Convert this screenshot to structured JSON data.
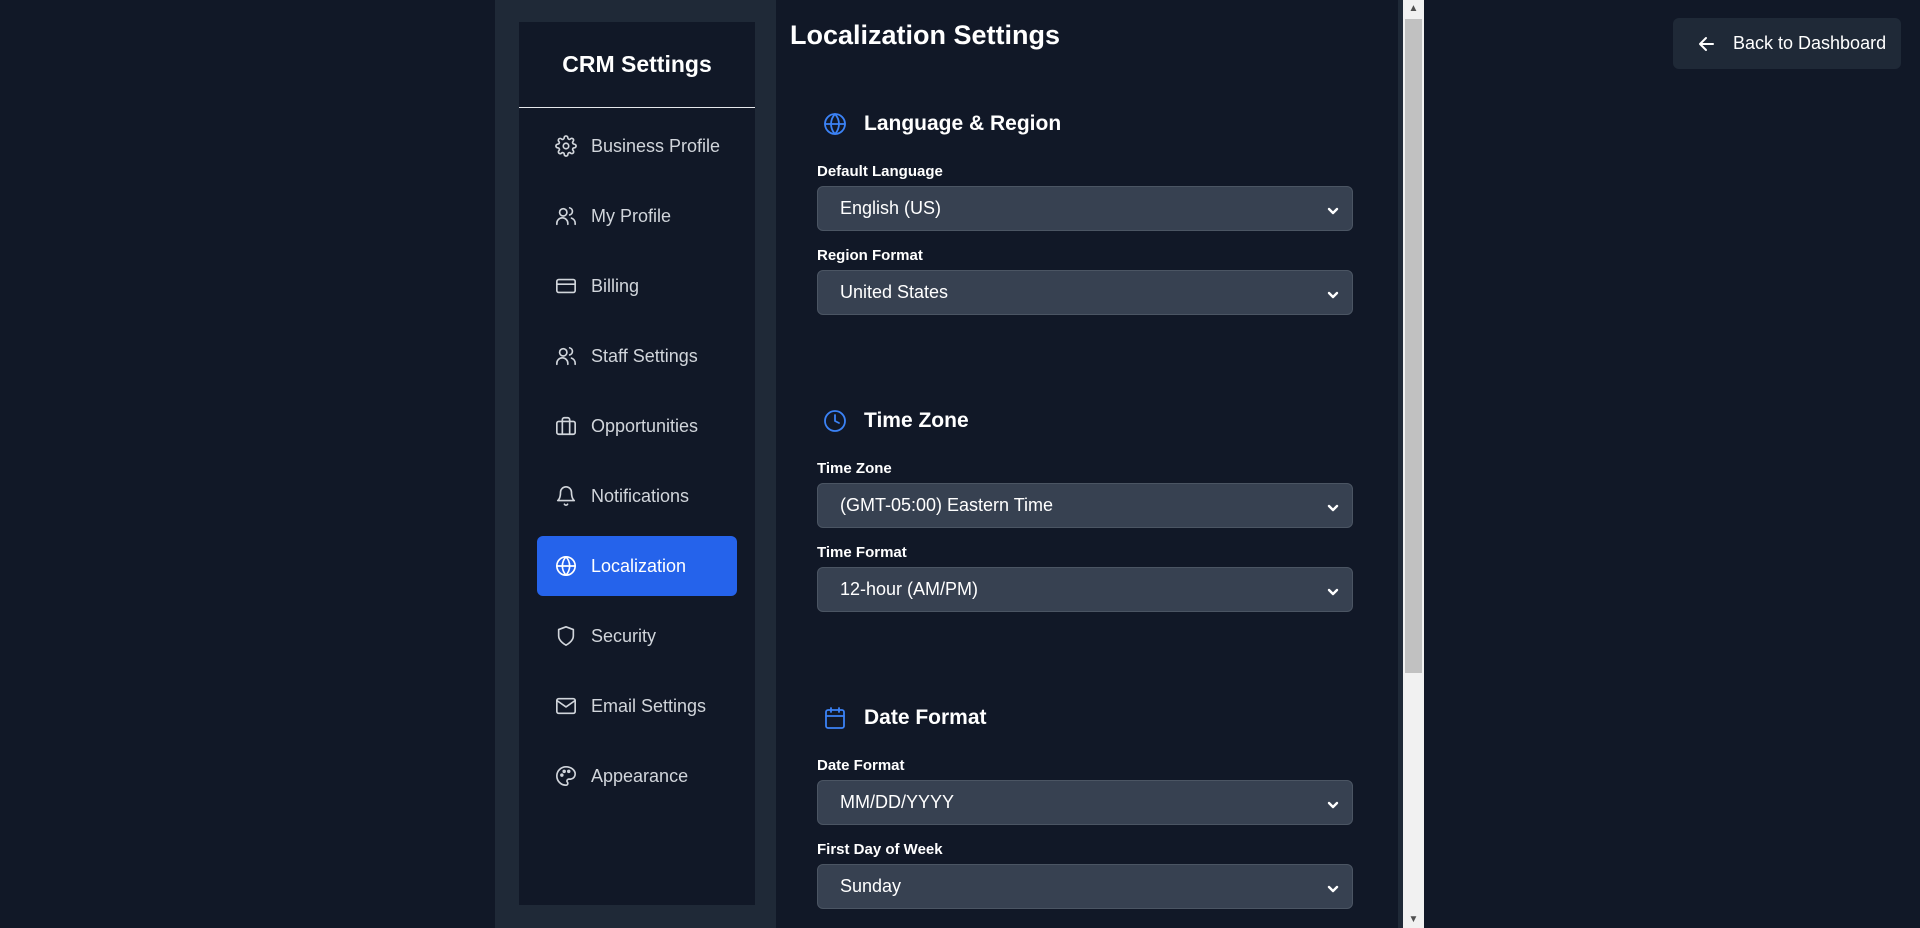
{
  "sidebar": {
    "title": "CRM Settings",
    "items": [
      {
        "label": "Business Profile",
        "icon": "gear-icon"
      },
      {
        "label": "My Profile",
        "icon": "users-icon"
      },
      {
        "label": "Billing",
        "icon": "credit-card-icon"
      },
      {
        "label": "Staff Settings",
        "icon": "users-icon"
      },
      {
        "label": "Opportunities",
        "icon": "briefcase-icon"
      },
      {
        "label": "Notifications",
        "icon": "bell-icon"
      },
      {
        "label": "Localization",
        "icon": "globe-icon",
        "active": true
      },
      {
        "label": "Security",
        "icon": "shield-icon"
      },
      {
        "label": "Email Settings",
        "icon": "mail-icon"
      },
      {
        "label": "Appearance",
        "icon": "palette-icon"
      }
    ]
  },
  "main": {
    "title": "Localization Settings",
    "sections": [
      {
        "title": "Language & Region",
        "icon": "globe-icon",
        "fields": [
          {
            "label": "Default Language",
            "value": "English (US)"
          },
          {
            "label": "Region Format",
            "value": "United States"
          }
        ]
      },
      {
        "title": "Time Zone",
        "icon": "clock-icon",
        "fields": [
          {
            "label": "Time Zone",
            "value": "(GMT-05:00) Eastern Time"
          },
          {
            "label": "Time Format",
            "value": "12-hour (AM/PM)"
          }
        ]
      },
      {
        "title": "Date Format",
        "icon": "calendar-icon",
        "fields": [
          {
            "label": "Date Format",
            "value": "MM/DD/YYYY"
          },
          {
            "label": "First Day of Week",
            "value": "Sunday"
          }
        ]
      }
    ]
  },
  "header": {
    "back_label": "Back to Dashboard"
  },
  "colors": {
    "background": "#111827",
    "panel": "#1f2937",
    "accent": "#2563eb",
    "section_icon": "#3b82f6",
    "select_bg": "#374151"
  }
}
